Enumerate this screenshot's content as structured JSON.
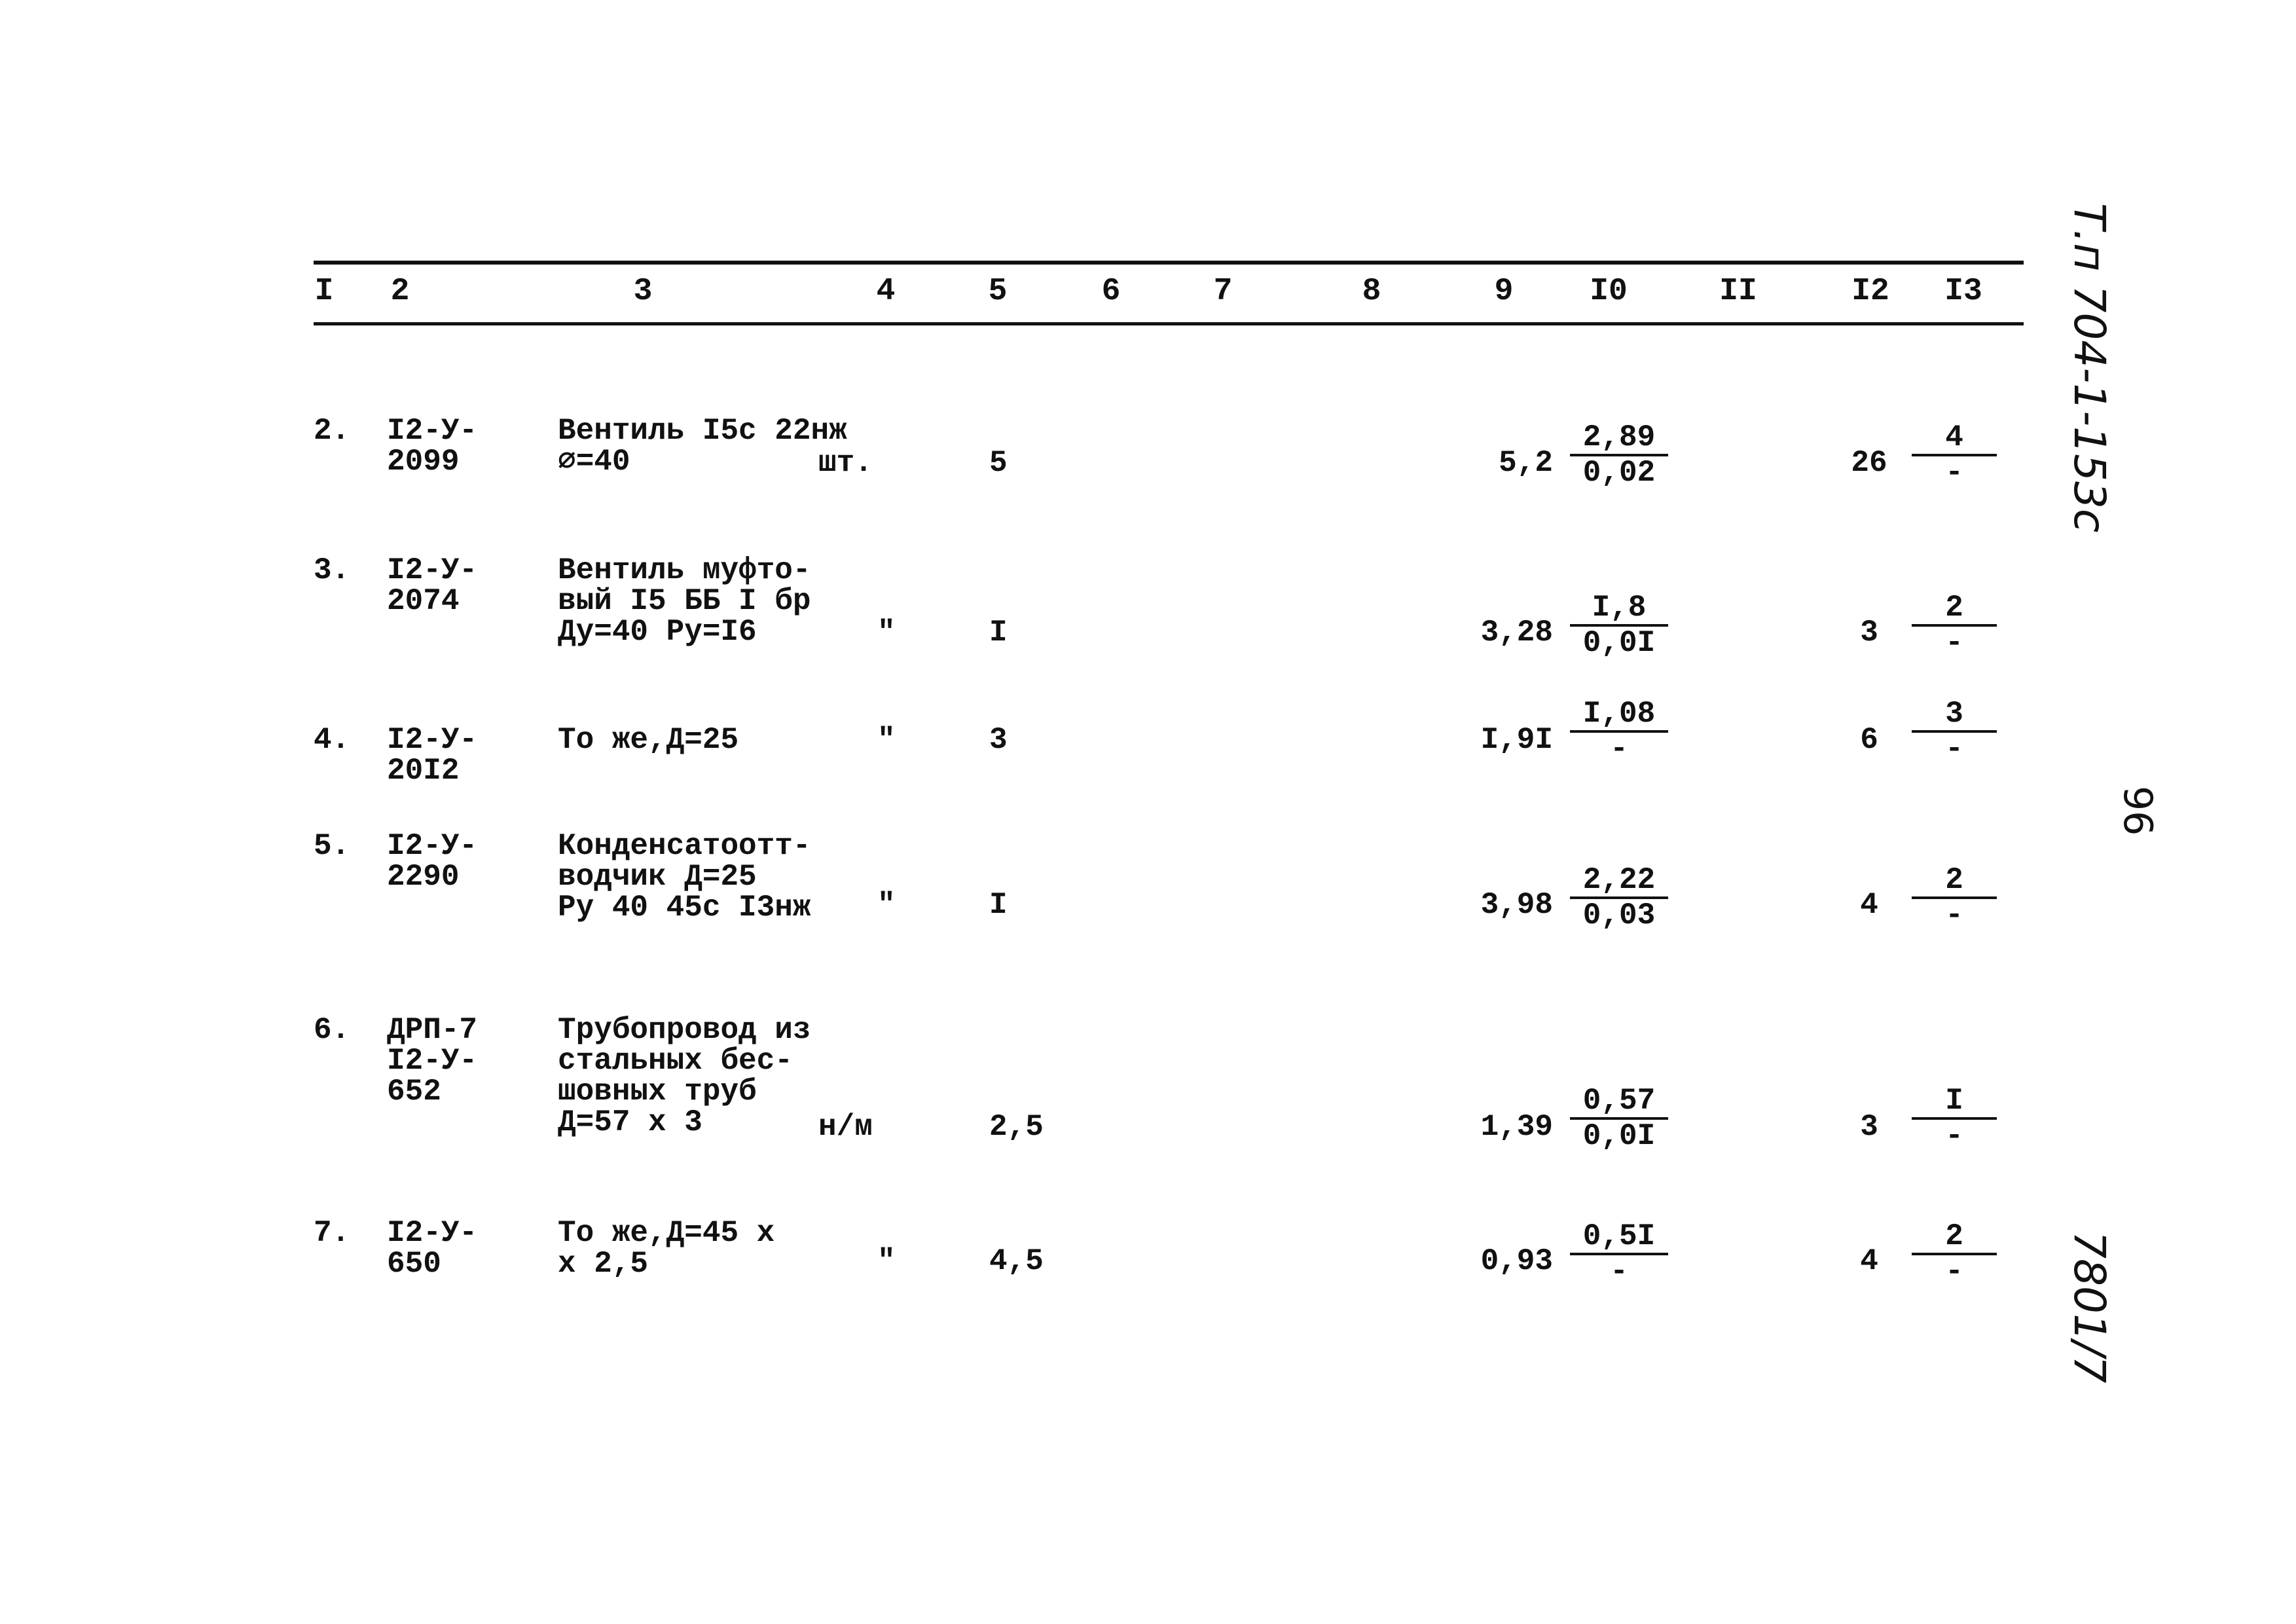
{
  "header": {
    "columns": [
      "I",
      "2",
      "3",
      "4",
      "5",
      "6",
      "7",
      "8",
      "9",
      "I0",
      "II",
      "I2",
      "I3"
    ]
  },
  "rows": [
    {
      "no": "2.",
      "code": [
        "I2-У-",
        "2099"
      ],
      "desc": [
        "Вентиль I5с 22нж",
        "⌀=40"
      ],
      "unit": "шт.",
      "c5": "5",
      "c9": "5,2",
      "c10_top": "2,89",
      "c10_bottom": "0,02",
      "c12": "26",
      "c13_top": "4",
      "c13_bottom": "-"
    },
    {
      "no": "3.",
      "code": [
        "I2-У-",
        "2074"
      ],
      "desc": [
        "Вентиль муфто-",
        "вый I5 ББ I бр",
        "Ду=40 Ру=I6"
      ],
      "unit": "\"",
      "c5": "I",
      "c9": "3,28",
      "c10_top": "I,8",
      "c10_bottom": "0,0I",
      "c12": "3",
      "c13_top": "2",
      "c13_bottom": "-"
    },
    {
      "no": "4.",
      "code": [
        "I2-У-",
        "20I2"
      ],
      "desc": [
        "То же,Д=25"
      ],
      "unit": "\"",
      "c5": "3",
      "c9": "I,9I",
      "c10_top": "I,08",
      "c10_bottom": "-",
      "c12": "6",
      "c13_top": "3",
      "c13_bottom": "-"
    },
    {
      "no": "5.",
      "code": [
        "I2-У-",
        "2290"
      ],
      "desc": [
        "Конденсатоотт-",
        "водчик Д=25",
        "Ру 40 45с I3нж"
      ],
      "unit": "\"",
      "c5": "I",
      "c9": "3,98",
      "c10_top": "2,22",
      "c10_bottom": "0,03",
      "c12": "4",
      "c13_top": "2",
      "c13_bottom": "-"
    },
    {
      "no": "6.",
      "code": [
        "ДРП-7",
        "I2-У-",
        "652"
      ],
      "desc": [
        "Трубопровод из",
        "стальных бес-",
        "шовных труб",
        "Д=57 х 3"
      ],
      "unit": "н/м",
      "c5": "2,5",
      "c9": "1,39",
      "c10_top": "0,57",
      "c10_bottom": "0,0I",
      "c12": "3",
      "c13_top": "I",
      "c13_bottom": "-"
    },
    {
      "no": "7.",
      "code": [
        "I2-У-",
        "650"
      ],
      "desc": [
        "То же,Д=45 х",
        "х 2,5"
      ],
      "unit": "\"",
      "c5": "4,5",
      "c9": "0,93",
      "c10_top": "0,5I",
      "c10_bottom": "-",
      "c12": "4",
      "c13_top": "2",
      "c13_bottom": "-"
    }
  ],
  "margin_notes": {
    "top": "Т.п 704-1-153с",
    "page": "96",
    "bottom": "7801/7"
  }
}
